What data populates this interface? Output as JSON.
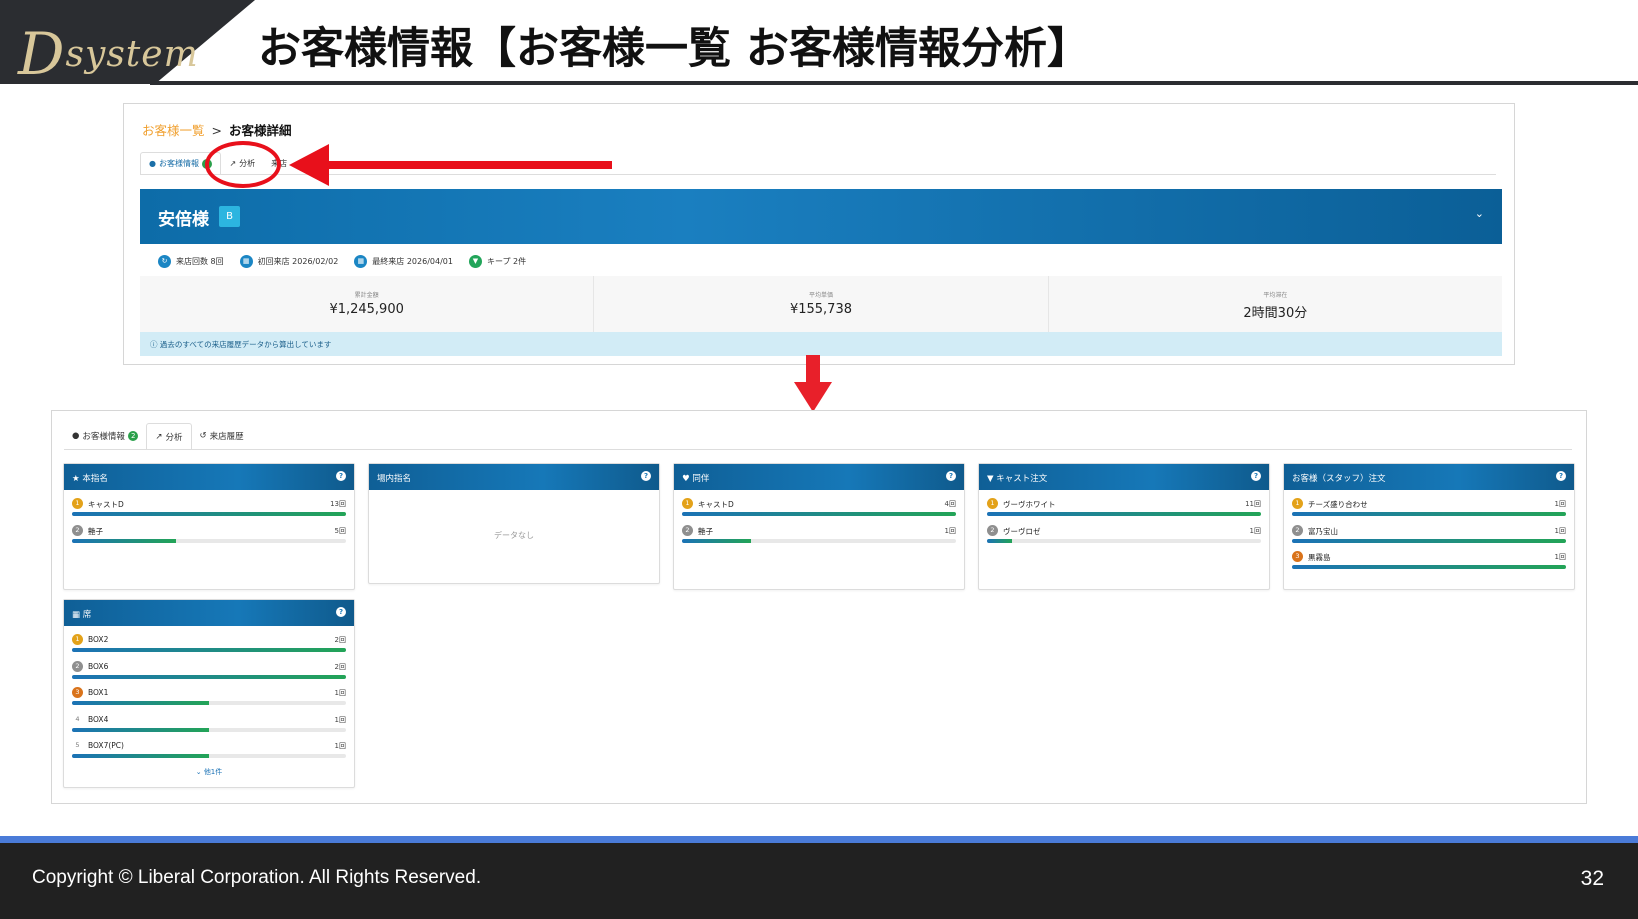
{
  "slide": {
    "logo_text_big": "D",
    "logo_text_rest": "system",
    "title": "お客様情報【お客様一覧 お客様情報分析】",
    "footer_copyright": "Copyright ©  Liberal Corporation. All Rights Reserved.",
    "page_number": "32"
  },
  "top_screen": {
    "breadcrumb_parent": "お客様一覧",
    "breadcrumb_separator": ">",
    "breadcrumb_current": "お客様詳細",
    "tabs": [
      {
        "label": "お客様情報",
        "badge": "2"
      },
      {
        "label": "分析"
      },
      {
        "label": "来店"
      }
    ],
    "customer_name": "安倍様",
    "rank": "B",
    "meta": [
      {
        "icon": "refresh-icon",
        "text": "来店回数 8回"
      },
      {
        "icon": "calendar-icon",
        "text": "初回来店 2026/02/02"
      },
      {
        "icon": "calendar-icon",
        "text": "最終来店 2026/04/01"
      },
      {
        "icon": "glass-icon",
        "text": "キープ 2件"
      }
    ],
    "stats": [
      {
        "label": "累計金額",
        "value": "¥1,245,900"
      },
      {
        "label": "平均単価",
        "value": "¥155,738"
      },
      {
        "label": "平均滞在",
        "value": "2時間30分"
      }
    ],
    "info_text": "過去のすべての来店履歴データから算出しています"
  },
  "bottom_screen": {
    "tabs": [
      {
        "label": "お客様情報",
        "badge": "2",
        "icon": "user-icon"
      },
      {
        "label": "分析",
        "icon": "chart-icon"
      },
      {
        "label": "来店履歴",
        "icon": "history-icon"
      }
    ],
    "cards": [
      {
        "title": "本指名",
        "icon": "star-icon",
        "rows": [
          {
            "rank": "1",
            "name": "キャストD",
            "count": "13回",
            "ratio": 1.0
          },
          {
            "rank": "2",
            "name": "艶子",
            "count": "5回",
            "ratio": 0.38
          }
        ]
      },
      {
        "title": "場内指名",
        "icon": "",
        "empty_text": "データなし",
        "rows": []
      },
      {
        "title": "同伴",
        "icon": "heart-icon",
        "rows": [
          {
            "rank": "1",
            "name": "キャストD",
            "count": "4回",
            "ratio": 1.0
          },
          {
            "rank": "2",
            "name": "艶子",
            "count": "1回",
            "ratio": 0.25
          }
        ]
      },
      {
        "title": "キャスト注文",
        "icon": "cocktail-icon",
        "rows": [
          {
            "rank": "1",
            "name": "ヴーヴホワイト",
            "count": "11回",
            "ratio": 1.0
          },
          {
            "rank": "2",
            "name": "ヴーヴロゼ",
            "count": "1回",
            "ratio": 0.09
          }
        ]
      },
      {
        "title": "お客様（スタッフ）注文",
        "icon": "",
        "rows": [
          {
            "rank": "1",
            "name": "チーズ盛り合わせ",
            "count": "1回",
            "ratio": 1.0
          },
          {
            "rank": "2",
            "name": "富乃宝山",
            "count": "1回",
            "ratio": 1.0
          },
          {
            "rank": "3",
            "name": "黒霧島",
            "count": "1回",
            "ratio": 1.0
          }
        ]
      },
      {
        "title": "席",
        "icon": "grid-icon",
        "rows": [
          {
            "rank": "1",
            "name": "BOX2",
            "count": "2回",
            "ratio": 1.0
          },
          {
            "rank": "2",
            "name": "BOX6",
            "count": "2回",
            "ratio": 1.0
          },
          {
            "rank": "3",
            "name": "BOX1",
            "count": "1回",
            "ratio": 0.5
          },
          {
            "rank": "4",
            "name": "BOX4",
            "count": "1回",
            "ratio": 0.5
          },
          {
            "rank": "5",
            "name": "BOX7(PC)",
            "count": "1回",
            "ratio": 0.5
          }
        ],
        "more_text": "他1件"
      }
    ]
  },
  "colors": {
    "accent_red": "#e8101b",
    "header_dark": "#2b2d31",
    "brand_blue": "#1678b8",
    "bar_green": "#23a457",
    "footer_stripe": "#4a7bd8"
  }
}
